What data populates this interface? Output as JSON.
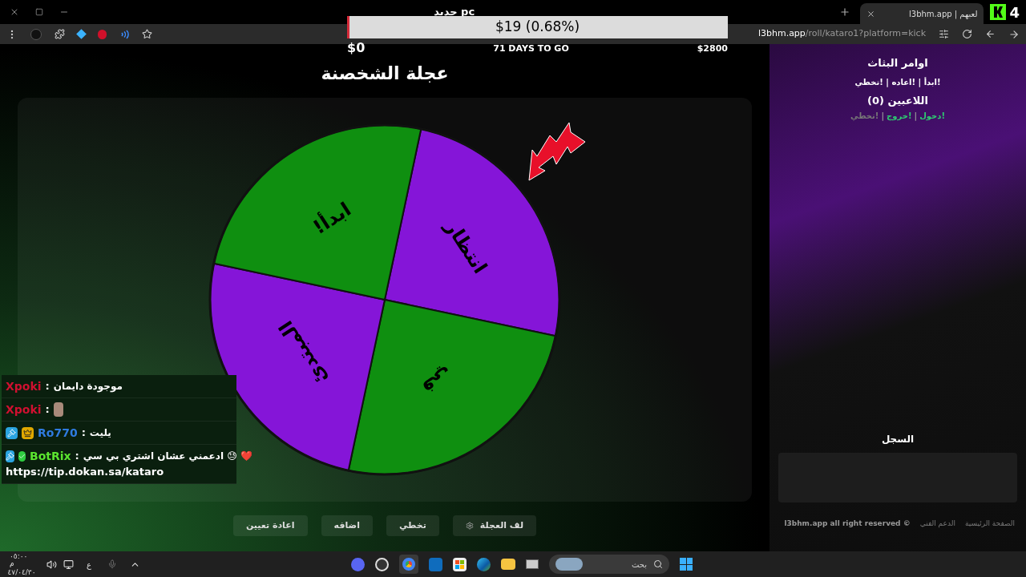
{
  "browser": {
    "window_title": "جديد pc",
    "tab": {
      "title": "l3bhm.app | لعبهم",
      "selected": true
    },
    "kick_badge": "4",
    "url_host": "l3bhm.app",
    "url_path": "/roll/kataro1?platform=kick"
  },
  "goal": {
    "amount": "$19 (0.68%)",
    "level": 0.0068,
    "start": "$0",
    "days_left": "71 DAYS TO GO",
    "target": "$2800"
  },
  "wheel": {
    "title": "عجلة الشخصنة",
    "segments": [
      {
        "label": "انتظار",
        "color": "#8515d8"
      },
      {
        "label": "في",
        "color": "#0f8f10"
      },
      {
        "label": "المبتدئ",
        "color": "#8515d8"
      },
      {
        "label": "!ابدأ",
        "color": "#0f8f10"
      }
    ]
  },
  "chat": [
    {
      "user": "Xpoki",
      "color": "#d01030",
      "separator": ":",
      "kind": "text",
      "message": "موجودة دايمان"
    },
    {
      "user": "Xpoki",
      "color": "#d01030",
      "separator": ":",
      "kind": "emote"
    },
    {
      "badges": [
        {
          "kind": "moderator"
        },
        {
          "kind": "subscriber"
        }
      ],
      "user": "Ro770",
      "color": "#2f7be0",
      "separator": ":",
      "kind": "text",
      "message": "يليت"
    },
    {
      "badges": [
        {
          "kind": "moderator"
        },
        {
          "kind": "verified"
        }
      ],
      "user": "BotRix",
      "color": "#5be52f",
      "separator": ":",
      "kind": "text",
      "message": "❤️ 😓 ادعمني عشان اشتري بي سي",
      "link": "https://tip.dokan.sa/kataro"
    }
  ],
  "actions": [
    {
      "kind": "spin",
      "label": "لف العجلة"
    },
    {
      "kind": "plain",
      "label": "تخطي"
    },
    {
      "kind": "plain",
      "label": "اضافه"
    },
    {
      "kind": "plain",
      "label": "اعادة تعيين"
    }
  ],
  "sidebar": {
    "commands_title": "اوامر البثاث",
    "commands": "!ابدأ | !اعاده | !تخطي",
    "players_title": "اللاعبين (0)",
    "player_commands": [
      {
        "kind": "command",
        "text": "!دخول",
        "color": "#2ecc71"
      },
      {
        "kind": "separator",
        "text": "|"
      },
      {
        "kind": "command",
        "text": "!خروج",
        "color": "#2ecc71"
      },
      {
        "kind": "separator",
        "text": "|"
      },
      {
        "kind": "command",
        "text": "!تخطي",
        "color": "#777777"
      }
    ],
    "log_title": "السجل"
  },
  "footer": {
    "links": [
      "الصفحة الرئيسية",
      "الدعم الفني"
    ],
    "copyright": "l3bhm.app all right reserved ©"
  },
  "taskbar": {
    "search_placeholder": "بحث",
    "language": "ع",
    "time": "٠٥:٠٠ م",
    "date": "٤٧/٠٤/٣٠"
  }
}
